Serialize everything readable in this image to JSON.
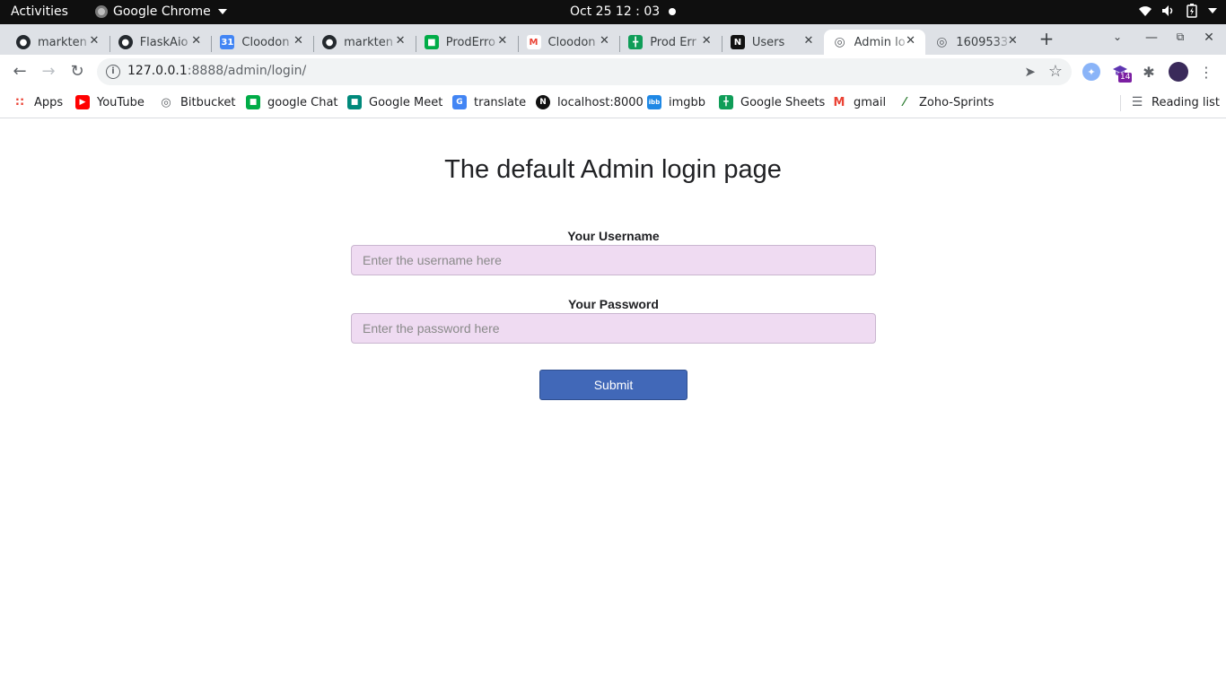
{
  "system_bar": {
    "activities": "Activities",
    "app_name": "Google Chrome",
    "clock": "Oct 25  12 : 03"
  },
  "tabs": [
    {
      "title": "markten",
      "icon": "github-icon",
      "color": "#24292e"
    },
    {
      "title": "FlaskAio",
      "icon": "github-icon",
      "color": "#24292e"
    },
    {
      "title": "Cloodon",
      "icon": "calendar-icon",
      "color": "#4285f4"
    },
    {
      "title": "markten",
      "icon": "github-icon",
      "color": "#24292e"
    },
    {
      "title": "ProdErro",
      "icon": "chat-icon",
      "color": "#00ac47"
    },
    {
      "title": "Cloodon",
      "icon": "gmail-icon",
      "color": "#ea4335"
    },
    {
      "title": "Prod Err",
      "icon": "sheets-icon",
      "color": "#0f9d58"
    },
    {
      "title": "Users",
      "icon": "notion-icon",
      "color": "#111111"
    },
    {
      "title": "Admin lo",
      "icon": "globe-icon",
      "color": "#5f6368"
    },
    {
      "title": "1609533",
      "icon": "globe-icon",
      "color": "#5f6368"
    }
  ],
  "active_tab_index": 8,
  "toolbar": {
    "url_host": "127.0.0.1",
    "url_path": ":8888/admin/login/"
  },
  "extensions": {
    "badge_count": "14"
  },
  "bookmarks": [
    {
      "label": "Apps",
      "icon": "apps-grid-icon",
      "color": "#ea4335"
    },
    {
      "label": "YouTube",
      "icon": "youtube-icon",
      "color": "#ff0000"
    },
    {
      "label": "Bitbucket",
      "icon": "globe-icon",
      "color": "#5f6368"
    },
    {
      "label": "google Chat",
      "icon": "chat-icon",
      "color": "#00ac47"
    },
    {
      "label": "Google Meet",
      "icon": "meet-icon",
      "color": "#00897b"
    },
    {
      "label": "translate",
      "icon": "translate-icon",
      "color": "#4285f4"
    },
    {
      "label": "localhost:8000",
      "icon": "notion-icon",
      "color": "#111111"
    },
    {
      "label": "imgbb",
      "icon": "imgbb-icon",
      "color": "#1e88e5"
    },
    {
      "label": "Google Sheets",
      "icon": "sheets-icon",
      "color": "#0f9d58"
    },
    {
      "label": "gmail",
      "icon": "gmail-icon",
      "color": "#ea4335"
    },
    {
      "label": "Zoho-Sprints",
      "icon": "zoho-icon",
      "color": "#2e7d32"
    }
  ],
  "reading_list": "Reading list",
  "page": {
    "heading": "The default Admin login page",
    "username_label": "Your Username",
    "username_placeholder": "Enter the username here",
    "password_label": "Your Password",
    "password_placeholder": "Enter the password here",
    "submit_label": "Submit"
  }
}
